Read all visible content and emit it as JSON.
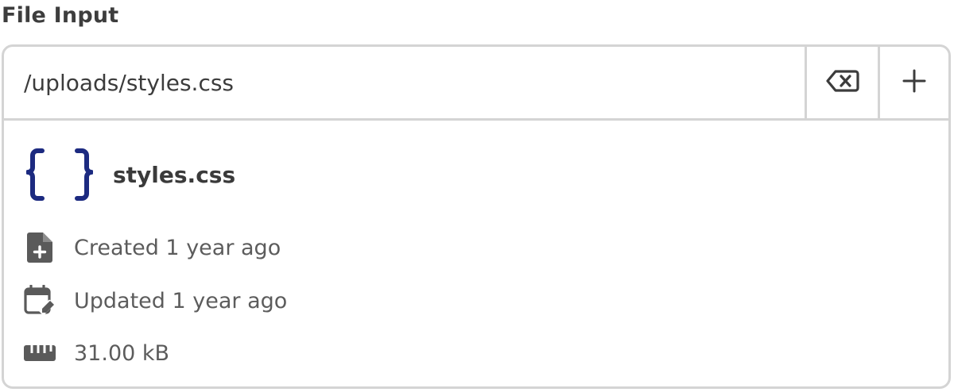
{
  "field": {
    "label": "File Input"
  },
  "input": {
    "value": "/uploads/styles.css",
    "placeholder": ""
  },
  "actions": {
    "clear_icon": "backspace-clear-icon",
    "add_icon": "plus-icon"
  },
  "file": {
    "type_icon": "curly-braces-icon",
    "name": "styles.css",
    "created": "Created 1 year ago",
    "updated": "Updated 1 year ago",
    "size": "31.00 kB"
  },
  "colors": {
    "accent": "#1c2a80",
    "border": "#d4d4d4",
    "icon_gray": "#5a5a5a",
    "text": "#3a3a3a",
    "muted_text": "#5c5c5c"
  }
}
